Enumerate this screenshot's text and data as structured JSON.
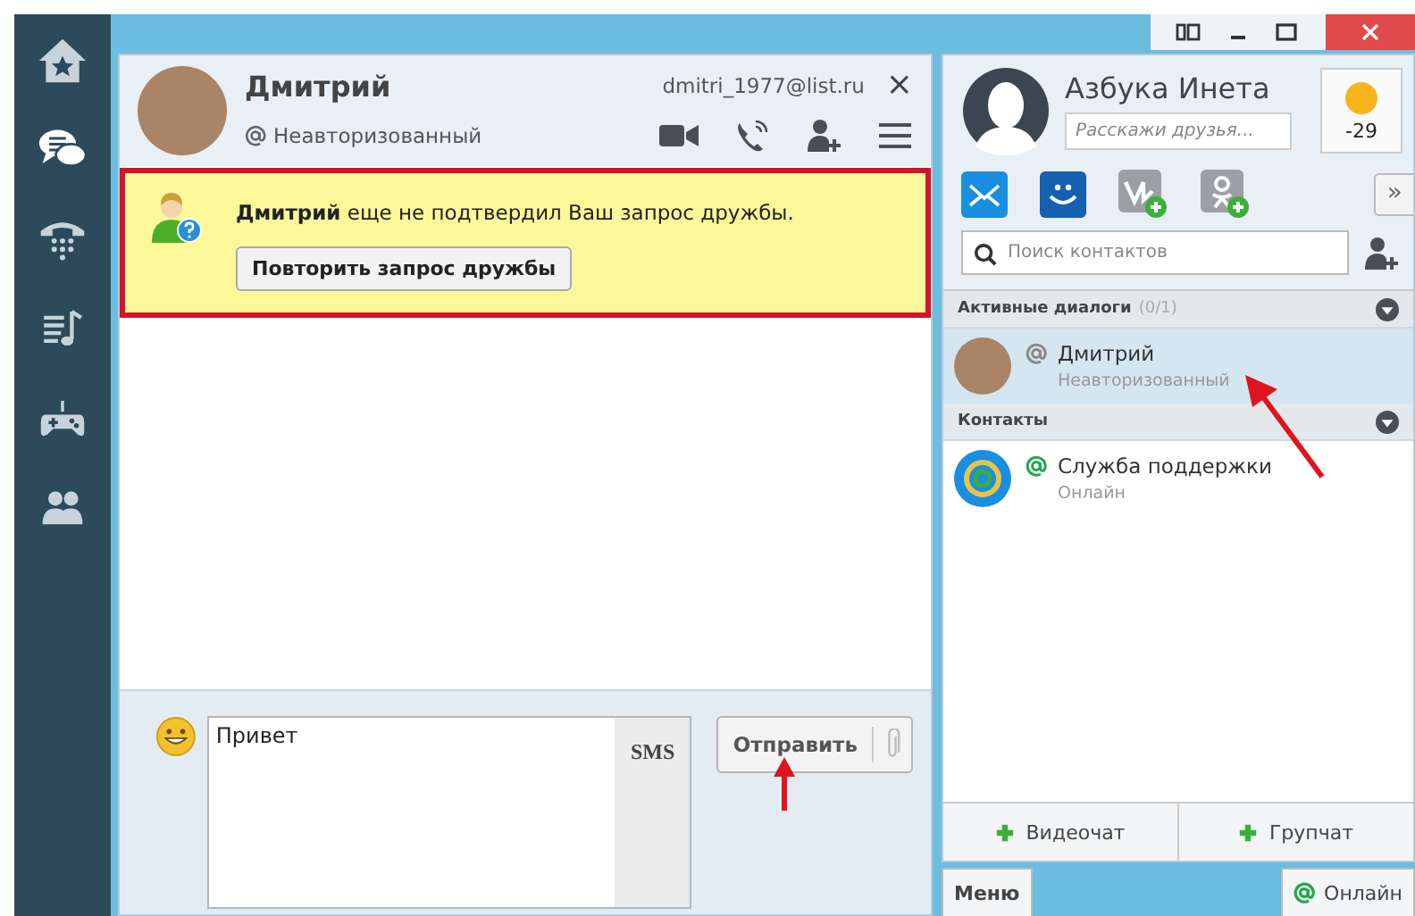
{
  "sidebar": {
    "items": [
      {
        "kind": "home",
        "selected": false
      },
      {
        "kind": "chat",
        "selected": true
      },
      {
        "kind": "phone",
        "selected": false
      },
      {
        "kind": "music",
        "selected": false
      },
      {
        "kind": "games",
        "selected": false
      },
      {
        "kind": "people",
        "selected": false
      }
    ]
  },
  "chat": {
    "name": "Дмитрий",
    "email": "dmitri_1977@list.ru",
    "close": "×",
    "status": "Неавторизованный",
    "notice": {
      "text": "**Дмитрий** еще не подтвердил Ваш запрос дружбы.",
      "button": "Повторить запрос дружбы"
    },
    "composer": {
      "value": "Привет",
      "sms": "SMS",
      "send": "Отправить"
    }
  },
  "profile": {
    "name": "Азбука Инета",
    "status_placeholder": "Расскажи друзья...",
    "temperature": "-29",
    "more": "»"
  },
  "search": {
    "placeholder": "Поиск контактов"
  },
  "sections": [
    {
      "title": "Активные диалоги",
      "count": "(0/1)",
      "contacts": [
        {
          "name": "Дмитрий",
          "status": "Неавторизованный",
          "kind": "photo",
          "online": false,
          "selected": true
        }
      ]
    },
    {
      "title": "Контакты",
      "contacts": [
        {
          "name": "Служба поддержки",
          "status": "Онлайн",
          "kind": "logo",
          "online": true,
          "selected": false
        }
      ]
    }
  ],
  "actions": [
    "Видеочат",
    "Групчат"
  ],
  "bottom_bar": {
    "menu": "Меню",
    "presence": "Онлайн"
  }
}
